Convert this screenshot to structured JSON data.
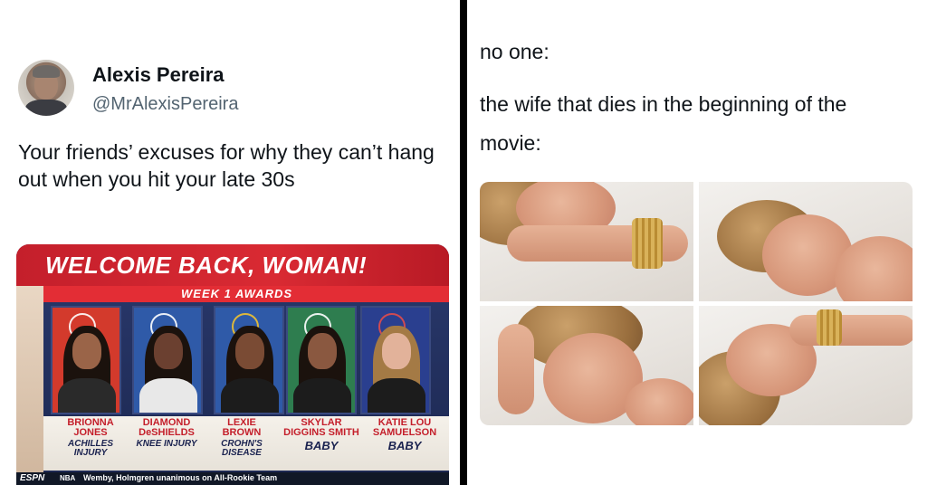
{
  "tweet": {
    "name": "Alexis Pereira",
    "handle": "@MrAlexisPereira",
    "text": "Your friends’ excuses for why they can’t hang out when you hit your late 30s"
  },
  "tv": {
    "title": "WELCOME BACK, WOMAN!",
    "subtitle": "WEEK 1 AWARDS",
    "players": [
      {
        "name": "BRIONNA JONES",
        "status": "ACHILLES INJURY",
        "color": "#d33a2c"
      },
      {
        "name": "DIAMOND DeSHIELDS",
        "status": "KNEE INJURY",
        "color": "#2f5aa8"
      },
      {
        "name": "LEXIE BROWN",
        "status": "CROHN'S DISEASE",
        "color": "#2f5aa8"
      },
      {
        "name": "SKYLAR DIGGINS SMITH",
        "status": "BABY",
        "color": "#2e7d4f"
      },
      {
        "name": "KATIE LOU SAMUELSON",
        "status": "BABY",
        "color": "#2a3f8f"
      }
    ],
    "ticker": {
      "network": "ESPN",
      "league": "NBA",
      "headline": "Wemby, Holmgren unanimous on All-Rookie Team"
    }
  },
  "meme": {
    "line1": "no one:",
    "line2": "the wife that dies in the beginning of the movie:"
  }
}
